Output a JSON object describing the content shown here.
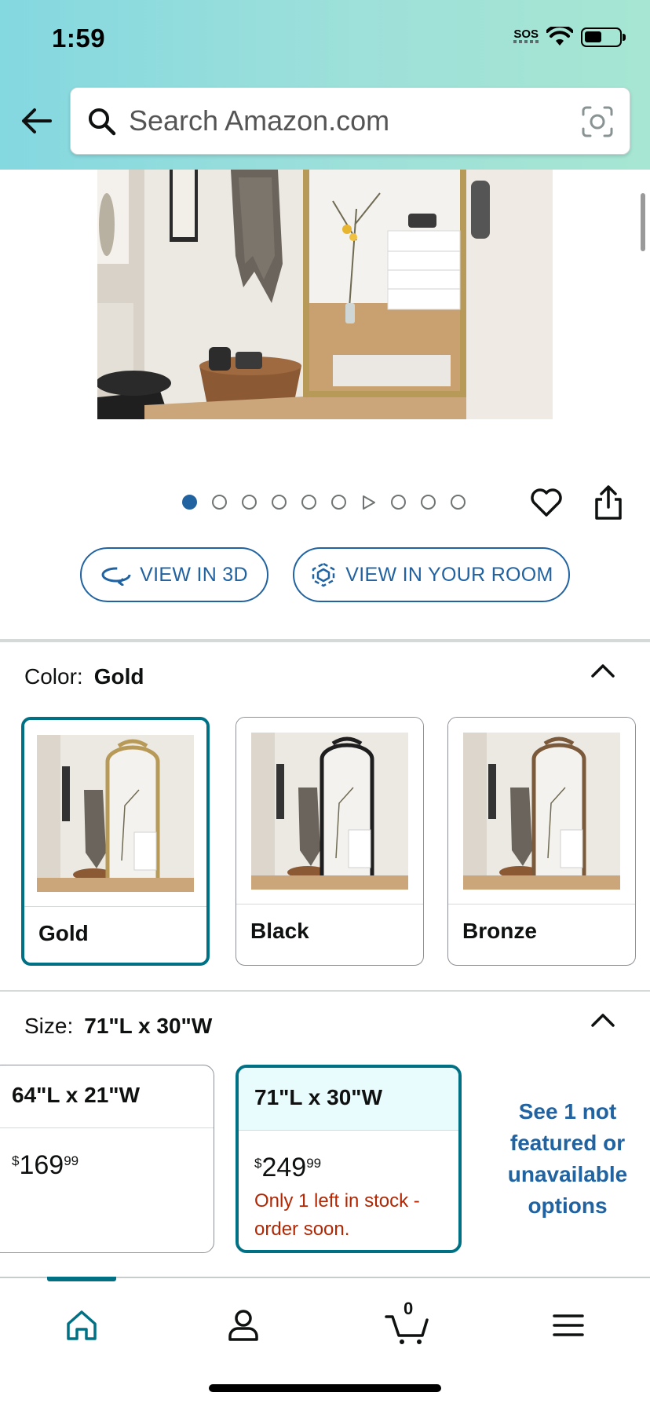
{
  "status_bar": {
    "time": "1:59",
    "carrier_text": "SOS",
    "wifi_icon": "wifi-icon",
    "battery_icon": "battery-icon"
  },
  "header": {
    "back_icon": "back-arrow-icon",
    "search": {
      "placeholder": "Search Amazon.com",
      "value": ""
    },
    "camera_icon": "camera-scan-icon",
    "gradient_colors": [
      "#84d8e0",
      "#a6e6d2"
    ]
  },
  "gallery": {
    "image_count": 10,
    "active_index": 0,
    "video_index": 6,
    "actions": {
      "wishlist_icon": "heart-icon",
      "share_icon": "share-icon"
    }
  },
  "view_buttons": {
    "view_3d": "VIEW IN 3D",
    "view_room": "VIEW IN YOUR ROOM"
  },
  "color": {
    "label": "Color:",
    "selected": "Gold",
    "options": [
      {
        "label": "Gold",
        "frame_color": "#b89a58",
        "selected": true
      },
      {
        "label": "Black",
        "frame_color": "#1e1e1e",
        "selected": false
      },
      {
        "label": "Bronze",
        "frame_color": "#7a5a3a",
        "selected": false
      }
    ]
  },
  "size": {
    "label": "Size:",
    "selected": "71\"L x 30\"W",
    "options": [
      {
        "label": "64\"L x 21\"W",
        "price_symbol": "$",
        "price_whole": "169",
        "price_fraction": "99",
        "stock": "",
        "selected": false
      },
      {
        "label": "71\"L x 30\"W",
        "price_symbol": "$",
        "price_whole": "249",
        "price_fraction": "99",
        "stock": "Only 1 left in stock - order soon.",
        "selected": true
      }
    ],
    "more_options_link": "See 1 not featured or unavailable options"
  },
  "bottom_nav": {
    "items": [
      "home-icon",
      "account-icon",
      "cart-icon",
      "menu-icon"
    ],
    "cart_count": "0",
    "active": "home-icon"
  },
  "colors": {
    "accent_teal": "#007185",
    "link_blue": "#2162a1",
    "stock_red": "#b12704"
  }
}
